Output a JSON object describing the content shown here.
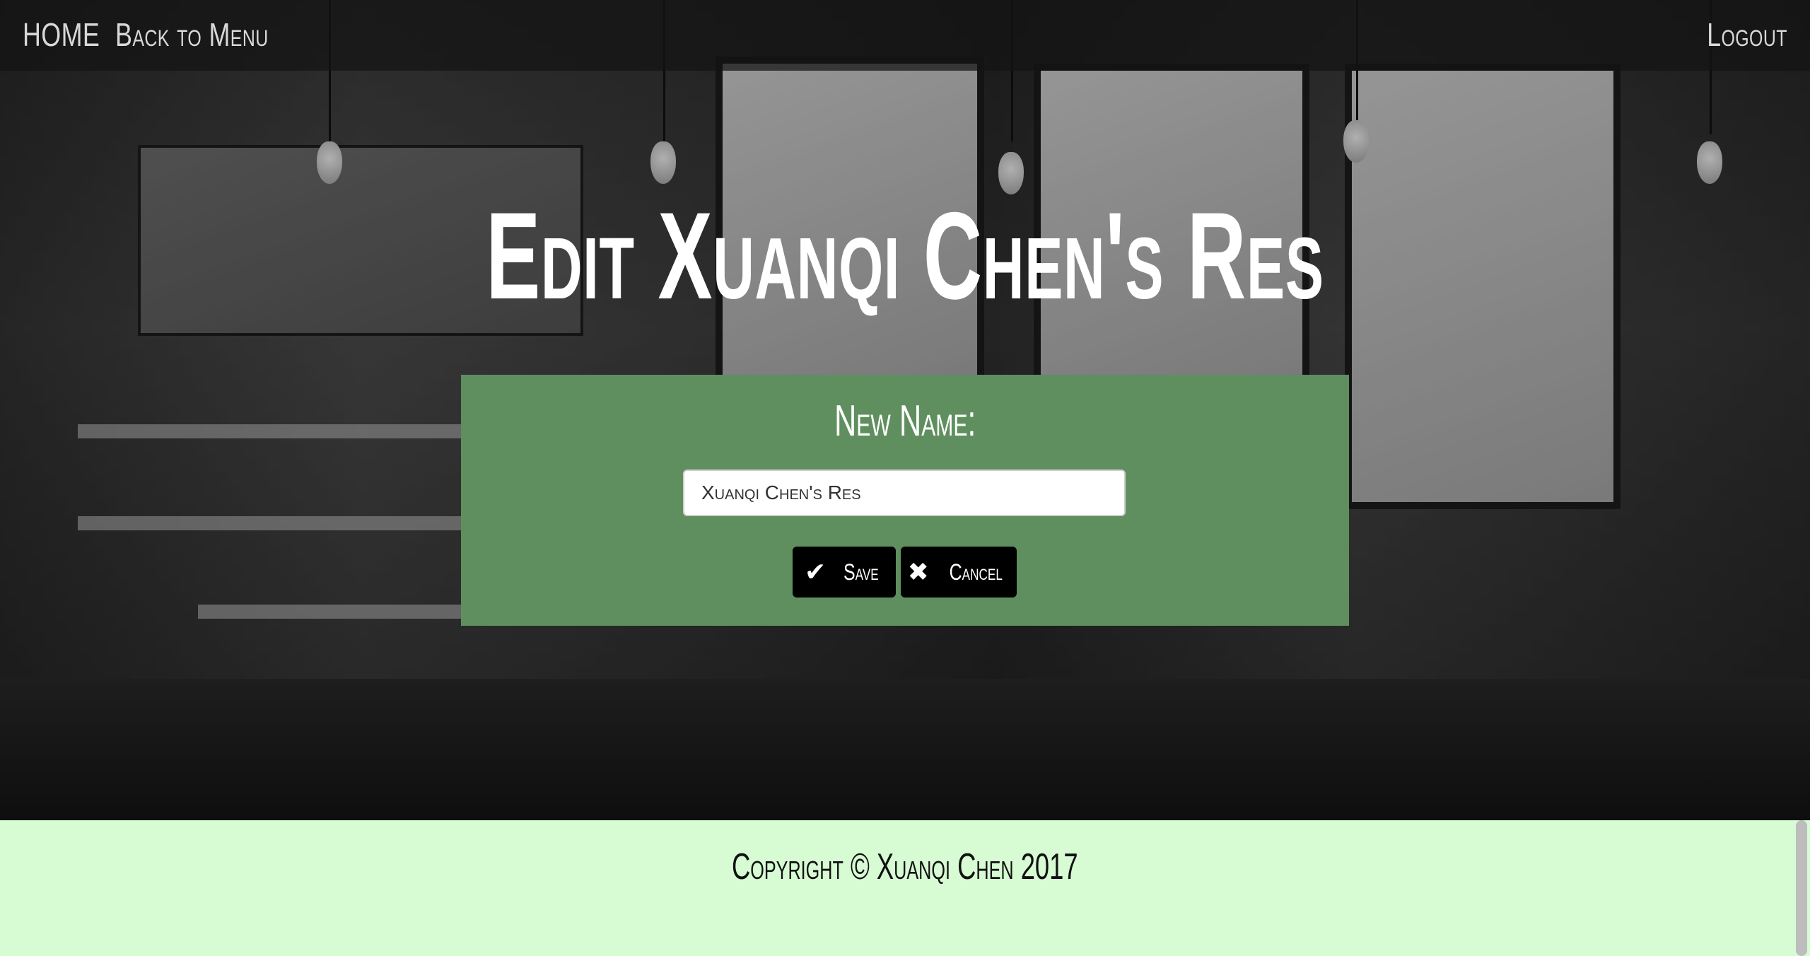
{
  "nav": {
    "home_label": "HOME",
    "back_label": "Back to Menu",
    "logout_label": "Logout"
  },
  "page_title": "Edit Xuanqi Chen's Res",
  "form": {
    "label": "New Name:",
    "name_value": "Xuanqi Chen's Res",
    "save_label": "Save",
    "save_icon": "check-icon",
    "cancel_label": "Cancel",
    "cancel_icon": "close-icon",
    "panel_color": "#5f8f5e"
  },
  "footer": {
    "copyright": "Copyright © Xuanqi Chen 2017",
    "background_color": "#d7fcd4"
  }
}
